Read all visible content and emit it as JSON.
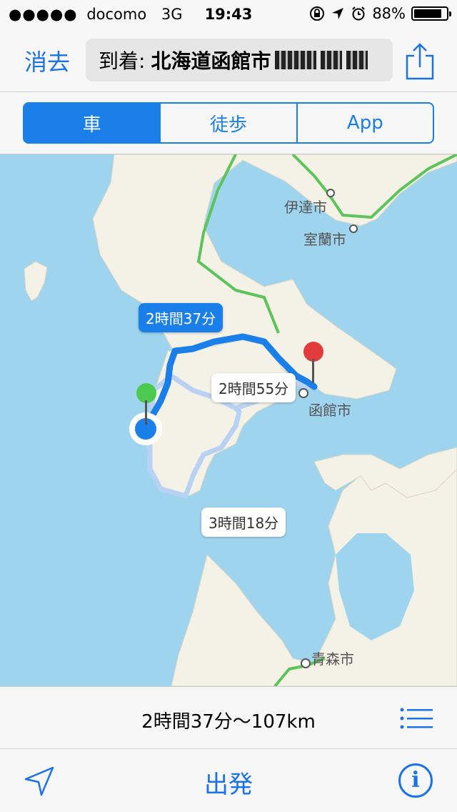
{
  "status_bar": {
    "carrier": "docomo",
    "network": "3G",
    "time": "19:43",
    "battery": "88%"
  },
  "nav": {
    "clear_label": "消去",
    "destination_prefix": "到着:",
    "destination_value": "北海道函館市"
  },
  "transport_tabs": [
    "車",
    "徒歩",
    "App"
  ],
  "map": {
    "places": [
      "伊達市",
      "室蘭市",
      "函館市",
      "青森市"
    ],
    "routes": [
      {
        "time": "2時間37分",
        "selected": true
      },
      {
        "time": "2時間55分",
        "selected": false
      },
      {
        "time": "3時間18分",
        "selected": false
      }
    ]
  },
  "summary": {
    "text": "2時間37分〜107km"
  },
  "toolbar": {
    "go_label": "出発",
    "info_label": "i"
  },
  "colors": {
    "accent": "#1a73e8",
    "water": "#9fd4ef",
    "land": "#f4f1e6",
    "route_selected": "#1a7fe8",
    "route_alt": "#b9d2f3",
    "highway": "#5cc45a"
  }
}
